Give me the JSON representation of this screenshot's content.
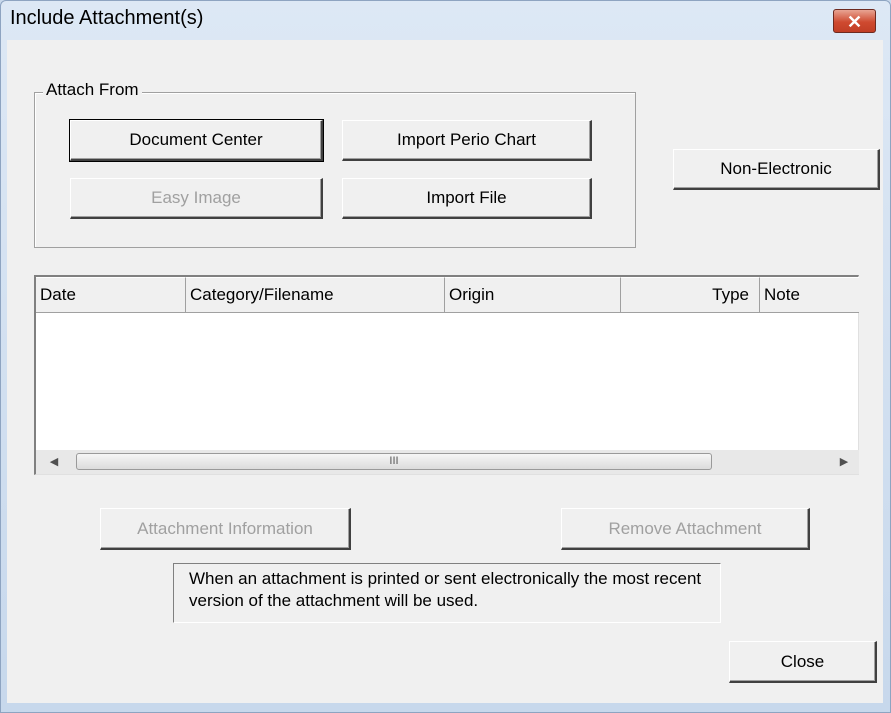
{
  "window": {
    "title": "Include Attachment(s)",
    "close_glyph": "✕"
  },
  "attach_from": {
    "label": "Attach From",
    "document_center": "Document Center",
    "import_perio_chart": "Import Perio Chart",
    "easy_image": "Easy Image",
    "import_file": "Import File"
  },
  "non_electronic": "Non-Electronic",
  "table": {
    "columns": [
      "Date",
      "Category/Filename",
      "Origin",
      "Type",
      "Note"
    ],
    "rows": []
  },
  "scrollbar": {
    "left_arrow": "◀",
    "right_arrow": "▶",
    "grip": "III"
  },
  "buttons": {
    "attachment_information": "Attachment Information",
    "remove_attachment": "Remove Attachment",
    "close": "Close"
  },
  "info_text": "When an attachment is printed or sent electronically the most recent version of the attachment will be used."
}
